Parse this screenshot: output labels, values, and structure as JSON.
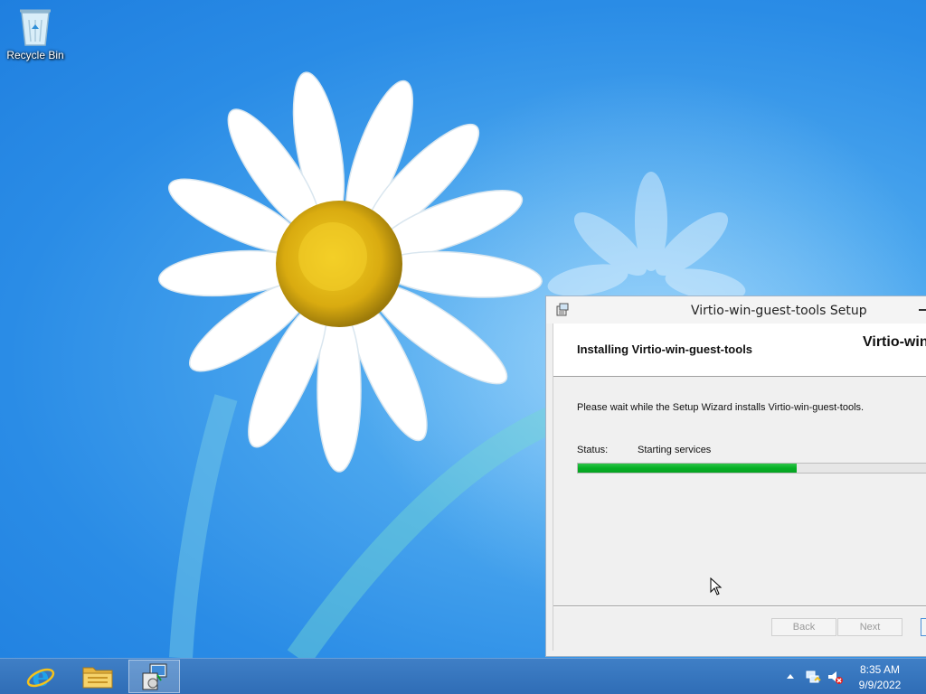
{
  "desktop": {
    "icons": [
      {
        "label": "Recycle Bin",
        "icon": "recycle-bin-icon"
      }
    ]
  },
  "setup_window": {
    "title": "Virtio-win-guest-tools Setup",
    "app_icon": "installer-icon",
    "banner_title": "Installing Virtio-win-guest-tools",
    "banner_brand": "Virtio-win",
    "description": "Please wait while the Setup Wizard installs Virtio-win-guest-tools.",
    "status_label": "Status:",
    "status_value": "Starting services",
    "progress_fraction": 0.58,
    "progress_color": "#06b025",
    "buttons": {
      "back": "Back",
      "next": "Next"
    }
  },
  "taskbar": {
    "pinned": [
      {
        "name": "internet-explorer-icon"
      },
      {
        "name": "file-explorer-icon"
      },
      {
        "name": "setup-installer-icon",
        "active": true
      }
    ],
    "tray": {
      "icons": [
        "show-hidden-icons-chevron",
        "network-icon",
        "volume-muted-icon"
      ],
      "time": "8:35 AM",
      "date": "9/9/2022"
    },
    "color": "#3574bd"
  }
}
